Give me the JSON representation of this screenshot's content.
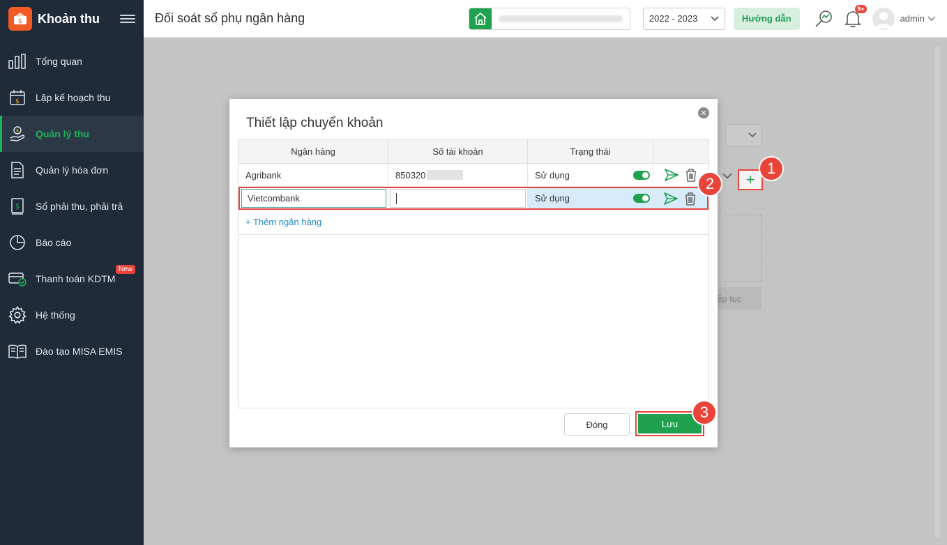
{
  "app": {
    "title": "Khoản thu"
  },
  "sidebar": {
    "items": [
      {
        "label": "Tổng quan",
        "icon": "bar-chart-icon"
      },
      {
        "label": "Lập kế hoạch thu",
        "icon": "calendar-money-icon"
      },
      {
        "label": "Quản lý thu",
        "icon": "hand-coin-icon",
        "active": true
      },
      {
        "label": "Quản lý hóa đơn",
        "icon": "document-icon"
      },
      {
        "label": "Sổ phải thu, phải trả",
        "icon": "ledger-icon"
      },
      {
        "label": "Báo cáo",
        "icon": "pie-chart-icon"
      },
      {
        "label": "Thanh toán KDTM",
        "icon": "card-payment-icon",
        "badge": "New"
      },
      {
        "label": "Hệ thống",
        "icon": "gear-icon"
      },
      {
        "label": "Đào tạo MISA EMIS",
        "icon": "book-icon"
      }
    ]
  },
  "topbar": {
    "page_title": "Đối soát sổ phụ ngân hàng",
    "year": "2022 - 2023",
    "guide_label": "Hướng dẫn",
    "notif_badge": "9+",
    "username": "admin"
  },
  "background": {
    "continue_label": "ếp tục"
  },
  "modal": {
    "title": "Thiết lập chuyển khoản",
    "columns": [
      "Ngân hàng",
      "Số tài khoản",
      "Trạng thái"
    ],
    "rows": [
      {
        "bank": "Agribank",
        "account": "850320",
        "status": "Sử dụng"
      },
      {
        "bank": "Vietcombank",
        "account": "",
        "status": "Sử dụng"
      }
    ],
    "add_bank_label": "+ Thêm ngân hàng",
    "close_label": "Đóng",
    "save_label": "Lưu"
  },
  "steps": [
    "1",
    "2",
    "3"
  ],
  "colors": {
    "sidebar_bg": "#1f2b38",
    "accent_green": "#20a150",
    "highlight_red": "#e8443a",
    "link_blue": "#1e88c8"
  }
}
